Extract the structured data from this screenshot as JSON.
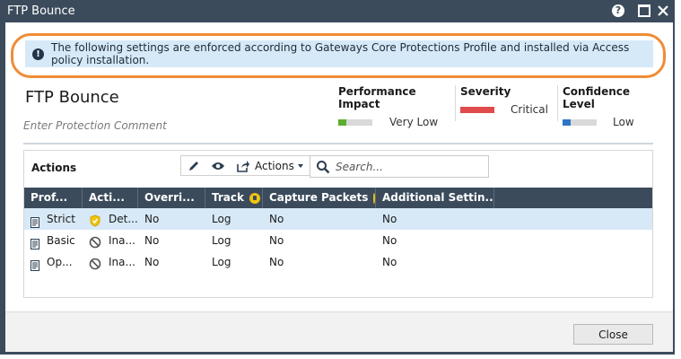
{
  "window": {
    "title": "FTP Bounce"
  },
  "banner": {
    "text": "The following settings are enforced according to Gateways Core Protections Profile and installed via Access policy installation."
  },
  "protection": {
    "name": "FTP Bounce",
    "comment_placeholder": "Enter Protection Comment"
  },
  "metrics": {
    "performance": {
      "label": "Performance Impact",
      "value": "Very Low",
      "level": 1,
      "max": 4,
      "color": "#5cae2e"
    },
    "severity": {
      "label": "Severity",
      "value": "Critical",
      "level": 4,
      "max": 4,
      "color": "#e04b4b"
    },
    "confidence": {
      "label": "Confidence Level",
      "value": "Low",
      "level": 1,
      "max": 4,
      "color": "#2e75c7"
    }
  },
  "actions_section": {
    "label": "Actions",
    "menu_label": "Actions",
    "search_placeholder": "Search..."
  },
  "table": {
    "columns": [
      "Prof...",
      "Acti...",
      "Overri...",
      "Track",
      "Capture Packets",
      "Additional Settin..."
    ],
    "rows": [
      {
        "profile": "Strict",
        "action": "Det...",
        "action_icon": "shield-icon",
        "override": "No",
        "track": "Log",
        "capture": "No",
        "additional": "No",
        "selected": true
      },
      {
        "profile": "Basic",
        "action": "Ina...",
        "action_icon": "inactive-icon",
        "override": "No",
        "track": "Log",
        "capture": "No",
        "additional": "No",
        "selected": false
      },
      {
        "profile": "Op...",
        "action": "Ina...",
        "action_icon": "inactive-icon",
        "override": "No",
        "track": "Log",
        "capture": "No",
        "additional": "No",
        "selected": false
      }
    ]
  },
  "footer": {
    "close_label": "Close"
  }
}
